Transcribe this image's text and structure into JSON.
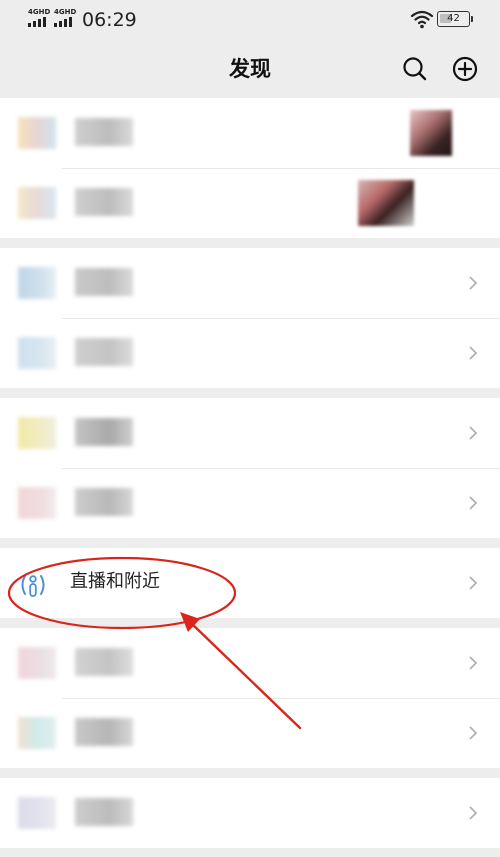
{
  "status_bar": {
    "network_1": "4GHD",
    "network_2": "4GHD",
    "time": "06:29",
    "battery": "42",
    "battery_level_percent": 42
  },
  "nav": {
    "title": "发现",
    "search_icon": "search-icon",
    "add_icon": "plus-circle-icon"
  },
  "menu": {
    "live_nearby_label": "直播和附近",
    "live_nearby_icon": "live-person-icon"
  },
  "colors": {
    "background": "#ededed",
    "card": "#ffffff",
    "text": "#222222",
    "chevron": "#b2b2b2",
    "live_icon_accent": "#4d8fd6",
    "annotation_red": "#d9261c"
  }
}
